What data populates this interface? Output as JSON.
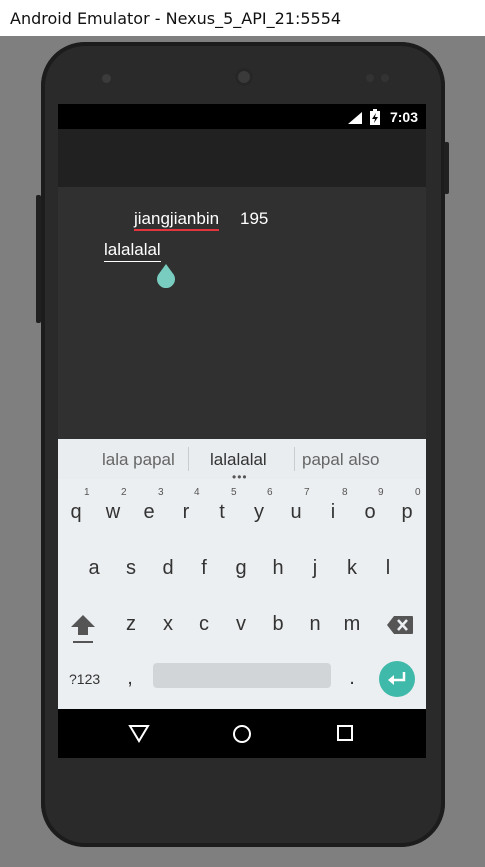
{
  "window": {
    "title": "Android Emulator - Nexus_5_API_21:5554"
  },
  "status_bar": {
    "time": "7:03"
  },
  "content": {
    "name": "jiangjianbin",
    "count": "195",
    "input_value": "lalalalal"
  },
  "suggestions": [
    "lala papal",
    "lalalalal",
    "papal also"
  ],
  "keyboard": {
    "row1": [
      "q",
      "w",
      "e",
      "r",
      "t",
      "y",
      "u",
      "i",
      "o",
      "p"
    ],
    "row1_hints": [
      "1",
      "2",
      "3",
      "4",
      "5",
      "6",
      "7",
      "8",
      "9",
      "0"
    ],
    "row2": [
      "a",
      "s",
      "d",
      "f",
      "g",
      "h",
      "j",
      "k",
      "l"
    ],
    "row3": [
      "z",
      "x",
      "c",
      "v",
      "b",
      "n",
      "m"
    ],
    "symbols_label": "?123",
    "comma": ",",
    "period": "."
  },
  "colors": {
    "accent_teal": "#3fb9a9",
    "spell_underline": "#e2353d"
  },
  "icons": [
    "signal-icon",
    "battery-icon",
    "water-drop-handle-icon",
    "shift-icon",
    "backspace-icon",
    "enter-icon",
    "back-icon",
    "home-icon",
    "recents-icon"
  ]
}
